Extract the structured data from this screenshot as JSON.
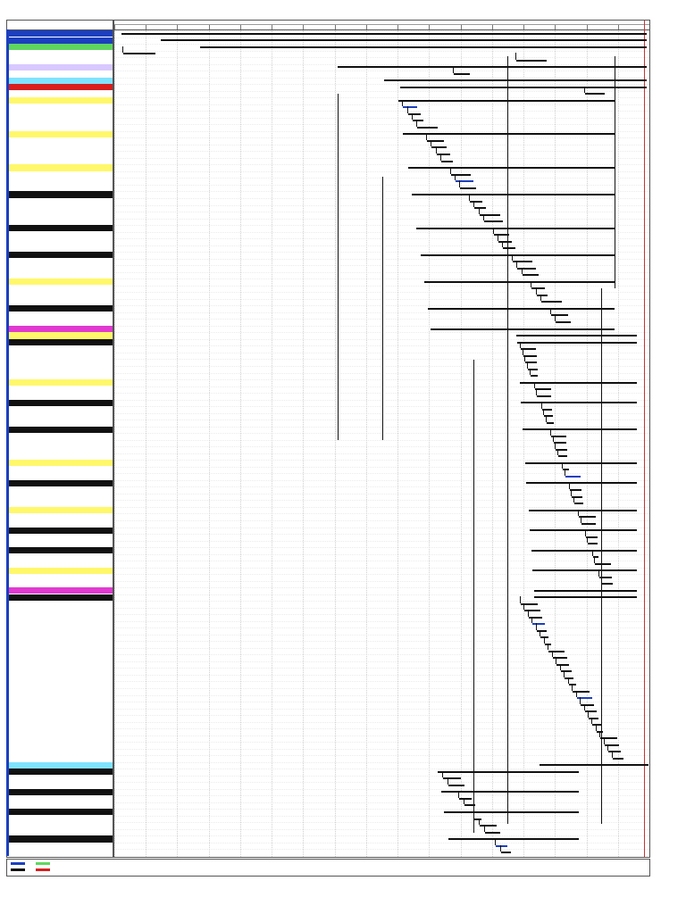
{
  "header": {
    "left": "",
    "center": "",
    "right": ""
  },
  "table": {
    "columns": [
      "",
      "",
      "",
      ""
    ],
    "rows": [
      {
        "level": 0,
        "name": "",
        "start": "",
        "finish": "",
        "style": "sum-blue"
      },
      {
        "level": 0,
        "name": "",
        "start": "",
        "finish": "",
        "style": "sum-blue"
      },
      {
        "level": 1,
        "name": "",
        "start": "",
        "finish": "",
        "style": "sum-green"
      },
      {
        "level": 2,
        "name": "",
        "start": "",
        "finish": "",
        "style": ""
      },
      {
        "level": 2,
        "name": "",
        "start": "",
        "finish": "",
        "style": ""
      },
      {
        "level": 1,
        "name": "",
        "start": "",
        "finish": "",
        "style": "sum-lav"
      },
      {
        "level": 2,
        "name": "",
        "start": "",
        "finish": "",
        "style": ""
      },
      {
        "level": 1,
        "name": "",
        "start": "",
        "finish": "",
        "style": "sum-cyan"
      },
      {
        "level": 2,
        "name": "",
        "start": "",
        "finish": "",
        "style": "sum-red"
      },
      {
        "level": 2,
        "name": "",
        "start": "",
        "finish": "",
        "style": ""
      },
      {
        "level": 3,
        "name": "",
        "start": "",
        "finish": "",
        "style": "sum-yellow"
      },
      {
        "level": 4,
        "name": "",
        "start": "",
        "finish": "",
        "style": ""
      },
      {
        "level": 4,
        "name": "",
        "start": "",
        "finish": "",
        "style": ""
      },
      {
        "level": 4,
        "name": "",
        "start": "",
        "finish": "",
        "style": ""
      },
      {
        "level": 4,
        "name": "",
        "start": "",
        "finish": "",
        "style": ""
      },
      {
        "level": 3,
        "name": "",
        "start": "",
        "finish": "",
        "style": "sum-yellow"
      },
      {
        "level": 4,
        "name": "",
        "start": "",
        "finish": "",
        "style": ""
      },
      {
        "level": 4,
        "name": "",
        "start": "",
        "finish": "",
        "style": ""
      },
      {
        "level": 4,
        "name": "",
        "start": "",
        "finish": "",
        "style": ""
      },
      {
        "level": 4,
        "name": "",
        "start": "",
        "finish": "",
        "style": ""
      },
      {
        "level": 3,
        "name": "",
        "start": "",
        "finish": "",
        "style": "sum-yellow"
      },
      {
        "level": 4,
        "name": "",
        "start": "",
        "finish": "",
        "style": ""
      },
      {
        "level": 4,
        "name": "",
        "start": "",
        "finish": "",
        "style": ""
      },
      {
        "level": 4,
        "name": "",
        "start": "",
        "finish": "",
        "style": ""
      },
      {
        "level": 3,
        "name": "",
        "start": "",
        "finish": "",
        "style": "sum-black"
      },
      {
        "level": 4,
        "name": "",
        "start": "",
        "finish": "",
        "style": ""
      },
      {
        "level": 4,
        "name": "",
        "start": "",
        "finish": "",
        "style": ""
      },
      {
        "level": 4,
        "name": "",
        "start": "",
        "finish": "",
        "style": ""
      },
      {
        "level": 4,
        "name": "",
        "start": "",
        "finish": "",
        "style": ""
      },
      {
        "level": 3,
        "name": "",
        "start": "",
        "finish": "",
        "style": "sum-black"
      },
      {
        "level": 4,
        "name": "",
        "start": "",
        "finish": "",
        "style": ""
      },
      {
        "level": 4,
        "name": "",
        "start": "",
        "finish": "",
        "style": ""
      },
      {
        "level": 4,
        "name": "",
        "start": "",
        "finish": "",
        "style": ""
      },
      {
        "level": 3,
        "name": "",
        "start": "",
        "finish": "",
        "style": "sum-black"
      },
      {
        "level": 4,
        "name": "",
        "start": "",
        "finish": "",
        "style": ""
      },
      {
        "level": 4,
        "name": "",
        "start": "",
        "finish": "",
        "style": ""
      },
      {
        "level": 4,
        "name": "",
        "start": "",
        "finish": "",
        "style": ""
      },
      {
        "level": 3,
        "name": "",
        "start": "",
        "finish": "",
        "style": "sum-yellow"
      },
      {
        "level": 4,
        "name": "",
        "start": "",
        "finish": "",
        "style": ""
      },
      {
        "level": 4,
        "name": "",
        "start": "",
        "finish": "",
        "style": ""
      },
      {
        "level": 4,
        "name": "",
        "start": "",
        "finish": "",
        "style": ""
      },
      {
        "level": 3,
        "name": "",
        "start": "",
        "finish": "",
        "style": "sum-black"
      },
      {
        "level": 4,
        "name": "",
        "start": "",
        "finish": "",
        "style": ""
      },
      {
        "level": 4,
        "name": "",
        "start": "",
        "finish": "",
        "style": ""
      },
      {
        "level": 2,
        "name": "",
        "start": "",
        "finish": "",
        "style": "sum-magenta"
      },
      {
        "level": 3,
        "name": "",
        "start": "",
        "finish": "",
        "style": "sum-yellow"
      },
      {
        "level": 3,
        "name": "",
        "start": "",
        "finish": "",
        "style": "sum-black"
      },
      {
        "level": 4,
        "name": "",
        "start": "",
        "finish": "",
        "style": ""
      },
      {
        "level": 4,
        "name": "",
        "start": "",
        "finish": "",
        "style": ""
      },
      {
        "level": 4,
        "name": "",
        "start": "",
        "finish": "",
        "style": ""
      },
      {
        "level": 4,
        "name": "",
        "start": "",
        "finish": "",
        "style": ""
      },
      {
        "level": 4,
        "name": "",
        "start": "",
        "finish": "",
        "style": ""
      },
      {
        "level": 3,
        "name": "",
        "start": "",
        "finish": "",
        "style": "sum-yellow"
      },
      {
        "level": 4,
        "name": "",
        "start": "",
        "finish": "",
        "style": ""
      },
      {
        "level": 4,
        "name": "",
        "start": "",
        "finish": "",
        "style": ""
      },
      {
        "level": 3,
        "name": "",
        "start": "",
        "finish": "",
        "style": "sum-black"
      },
      {
        "level": 4,
        "name": "",
        "start": "",
        "finish": "",
        "style": ""
      },
      {
        "level": 4,
        "name": "",
        "start": "",
        "finish": "",
        "style": ""
      },
      {
        "level": 4,
        "name": "",
        "start": "",
        "finish": "",
        "style": ""
      },
      {
        "level": 3,
        "name": "",
        "start": "",
        "finish": "",
        "style": "sum-black"
      },
      {
        "level": 4,
        "name": "",
        "start": "",
        "finish": "",
        "style": ""
      },
      {
        "level": 4,
        "name": "",
        "start": "",
        "finish": "",
        "style": ""
      },
      {
        "level": 4,
        "name": "",
        "start": "",
        "finish": "",
        "style": ""
      },
      {
        "level": 4,
        "name": "",
        "start": "",
        "finish": "",
        "style": ""
      },
      {
        "level": 3,
        "name": "",
        "start": "",
        "finish": "",
        "style": "sum-yellow"
      },
      {
        "level": 4,
        "name": "",
        "start": "",
        "finish": "",
        "style": ""
      },
      {
        "level": 4,
        "name": "",
        "start": "",
        "finish": "",
        "style": ""
      },
      {
        "level": 3,
        "name": "",
        "start": "",
        "finish": "",
        "style": "sum-black"
      },
      {
        "level": 4,
        "name": "",
        "start": "",
        "finish": "",
        "style": ""
      },
      {
        "level": 4,
        "name": "",
        "start": "",
        "finish": "",
        "style": ""
      },
      {
        "level": 4,
        "name": "",
        "start": "",
        "finish": "",
        "style": ""
      },
      {
        "level": 3,
        "name": "",
        "start": "",
        "finish": "",
        "style": "sum-yellow"
      },
      {
        "level": 4,
        "name": "",
        "start": "",
        "finish": "",
        "style": ""
      },
      {
        "level": 4,
        "name": "",
        "start": "",
        "finish": "",
        "style": ""
      },
      {
        "level": 3,
        "name": "",
        "start": "",
        "finish": "",
        "style": "sum-black"
      },
      {
        "level": 4,
        "name": "",
        "start": "",
        "finish": "",
        "style": ""
      },
      {
        "level": 4,
        "name": "",
        "start": "",
        "finish": "",
        "style": ""
      },
      {
        "level": 3,
        "name": "",
        "start": "",
        "finish": "",
        "style": "sum-black"
      },
      {
        "level": 4,
        "name": "",
        "start": "",
        "finish": "",
        "style": ""
      },
      {
        "level": 4,
        "name": "",
        "start": "",
        "finish": "",
        "style": ""
      },
      {
        "level": 3,
        "name": "",
        "start": "",
        "finish": "",
        "style": "sum-yellow"
      },
      {
        "level": 4,
        "name": "",
        "start": "",
        "finish": "",
        "style": ""
      },
      {
        "level": 4,
        "name": "",
        "start": "",
        "finish": "",
        "style": ""
      },
      {
        "level": 2,
        "name": "",
        "start": "",
        "finish": "",
        "style": "sum-magenta"
      },
      {
        "level": 3,
        "name": "",
        "start": "",
        "finish": "",
        "style": "sum-black"
      },
      {
        "level": 4,
        "name": "",
        "start": "",
        "finish": "",
        "style": ""
      },
      {
        "level": 4,
        "name": "",
        "start": "",
        "finish": "",
        "style": ""
      },
      {
        "level": 4,
        "name": "",
        "start": "",
        "finish": "",
        "style": ""
      },
      {
        "level": 4,
        "name": "",
        "start": "",
        "finish": "",
        "style": ""
      },
      {
        "level": 4,
        "name": "",
        "start": "",
        "finish": "",
        "style": ""
      },
      {
        "level": 4,
        "name": "",
        "start": "",
        "finish": "",
        "style": ""
      },
      {
        "level": 4,
        "name": "",
        "start": "",
        "finish": "",
        "style": ""
      },
      {
        "level": 4,
        "name": "",
        "start": "",
        "finish": "",
        "style": ""
      },
      {
        "level": 4,
        "name": "",
        "start": "",
        "finish": "",
        "style": ""
      },
      {
        "level": 4,
        "name": "",
        "start": "",
        "finish": "",
        "style": ""
      },
      {
        "level": 4,
        "name": "",
        "start": "",
        "finish": "",
        "style": ""
      },
      {
        "level": 4,
        "name": "",
        "start": "",
        "finish": "",
        "style": ""
      },
      {
        "level": 4,
        "name": "",
        "start": "",
        "finish": "",
        "style": ""
      },
      {
        "level": 4,
        "name": "",
        "start": "",
        "finish": "",
        "style": ""
      },
      {
        "level": 4,
        "name": "",
        "start": "",
        "finish": "",
        "style": ""
      },
      {
        "level": 4,
        "name": "",
        "start": "",
        "finish": "",
        "style": ""
      },
      {
        "level": 4,
        "name": "",
        "start": "",
        "finish": "",
        "style": ""
      },
      {
        "level": 4,
        "name": "",
        "start": "",
        "finish": "",
        "style": ""
      },
      {
        "level": 4,
        "name": "",
        "start": "",
        "finish": "",
        "style": ""
      },
      {
        "level": 4,
        "name": "",
        "start": "",
        "finish": "",
        "style": ""
      },
      {
        "level": 4,
        "name": "",
        "start": "",
        "finish": "",
        "style": ""
      },
      {
        "level": 4,
        "name": "",
        "start": "",
        "finish": "",
        "style": ""
      },
      {
        "level": 4,
        "name": "",
        "start": "",
        "finish": "",
        "style": ""
      },
      {
        "level": 4,
        "name": "",
        "start": "",
        "finish": "",
        "style": ""
      },
      {
        "level": 2,
        "name": "",
        "start": "",
        "finish": "",
        "style": "sum-cyan"
      },
      {
        "level": 3,
        "name": "",
        "start": "",
        "finish": "",
        "style": "sum-black"
      },
      {
        "level": 4,
        "name": "",
        "start": "",
        "finish": "",
        "style": ""
      },
      {
        "level": 4,
        "name": "",
        "start": "",
        "finish": "",
        "style": ""
      },
      {
        "level": 3,
        "name": "",
        "start": "",
        "finish": "",
        "style": "sum-black"
      },
      {
        "level": 4,
        "name": "",
        "start": "",
        "finish": "",
        "style": ""
      },
      {
        "level": 4,
        "name": "",
        "start": "",
        "finish": "",
        "style": ""
      },
      {
        "level": 3,
        "name": "",
        "start": "",
        "finish": "",
        "style": "sum-black"
      },
      {
        "level": 4,
        "name": "",
        "start": "",
        "finish": "",
        "style": ""
      },
      {
        "level": 4,
        "name": "",
        "start": "",
        "finish": "",
        "style": ""
      },
      {
        "level": 4,
        "name": "",
        "start": "",
        "finish": "",
        "style": ""
      },
      {
        "level": 3,
        "name": "",
        "start": "",
        "finish": "",
        "style": "sum-black"
      },
      {
        "level": 4,
        "name": "",
        "start": "",
        "finish": "",
        "style": ""
      },
      {
        "level": 4,
        "name": "",
        "start": "",
        "finish": "",
        "style": ""
      }
    ]
  },
  "timescale": {
    "top_label": "",
    "ticks": [
      "",
      "",
      "",
      "",
      "",
      "",
      "",
      "",
      "",
      "",
      "",
      "",
      "",
      "",
      "",
      "",
      ""
    ]
  },
  "legend": {
    "items": [
      {
        "label": "",
        "color": "#1c3fbf"
      },
      {
        "label": "",
        "color": "#5fd65f"
      },
      {
        "label": "",
        "color": "#111111"
      },
      {
        "label": "",
        "color": "#d91e1e"
      }
    ],
    "page": "",
    "footer_mid": "",
    "footer_right": ""
  },
  "colors": {
    "summary_blue": "#1c3fbf",
    "summary_green": "#5fd65f",
    "summary_yellow": "#fff86a",
    "summary_black": "#111111",
    "summary_magenta": "#e03ad0",
    "summary_cyan": "#7fe3ff",
    "status_line": "#cc3333"
  }
}
